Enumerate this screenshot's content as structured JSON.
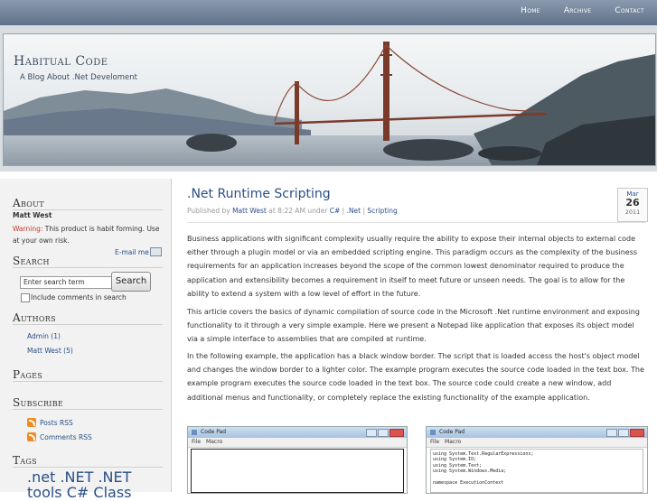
{
  "nav": {
    "items": [
      "Home",
      "Archive",
      "Contact"
    ]
  },
  "site": {
    "title": "Habitual Code",
    "tagline": "A Blog About .Net Develoment"
  },
  "sidebar": {
    "about": {
      "heading": "About",
      "name": "Matt West",
      "warning_label": "Warning:",
      "warning_text": " This product is habit forming. Use at your own risk.",
      "email": "E-mail me"
    },
    "search": {
      "heading": "Search",
      "input_value": "Enter search term",
      "button": "Search",
      "include_comments": "Include comments in search"
    },
    "authors": {
      "heading": "Authors",
      "items": [
        "Admin (1)",
        "Matt West (5)"
      ]
    },
    "pages": {
      "heading": "Pages"
    },
    "subscribe": {
      "heading": "Subscribe",
      "items": [
        "Posts RSS",
        "Comments RSS"
      ]
    },
    "tags": {
      "heading": "Tags",
      "items": [
        ".net",
        ".NET",
        ".NET",
        "tools",
        "C#",
        "Class"
      ]
    }
  },
  "post": {
    "title": ".Net Runtime Scripting",
    "meta_prefix": "Published by ",
    "author": "Matt West",
    "meta_time": " at 8:22 AM under ",
    "categories": [
      "C#",
      ".Net",
      "Scripting"
    ],
    "date": {
      "month": "Mar",
      "day": "26",
      "year": "2011"
    },
    "paragraphs": [
      "Business applications with significant complexity usually require the ability to expose their internal objects to external code either through a plugin model or via an embedded scripting engine. This paradigm occurs as the complexity of the business requirements for an application increases beyond the scope of the common lowest denominator required to produce the application and extensibility becomes a requirement in itself to meet future or unseen needs. The goal is to allow for the ability to extend a system with a low level of effort in the future.",
      "This article covers the basics of dynamic compilation of source code in the Microsoft .Net runtime environment and exposing functionality to it through a very simple example. Here we present a Notepad like application that exposes its object model via a simple interface to assemblies that are compiled at runtime.",
      "In the following example, the application has a black window border. The script that is loaded access the host's object model and changes the window border to a lighter color. The example program executes the source code loaded in the text box. The example program executes the source code loaded in the text box. The source code could create a new window, add additional menus and functionality, or completely replace the existing functionality of the example application."
    ],
    "screenshots": [
      {
        "title": "Code Pad",
        "menu": [
          "File",
          "Macro"
        ],
        "code": []
      },
      {
        "title": "Code Pad",
        "menu": [
          "File",
          "Macro"
        ],
        "code": [
          "using System.Text.RegularExpressions;",
          "using System.IO;",
          "using System.Text;",
          "using System.Windows.Media;",
          "",
          "namespace ExecutionContext"
        ]
      }
    ]
  }
}
